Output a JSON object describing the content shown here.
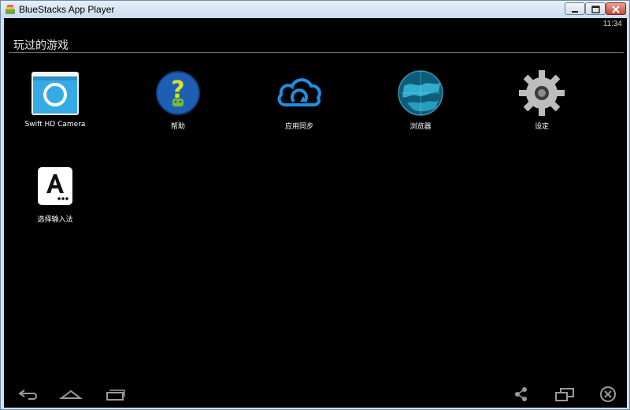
{
  "window": {
    "title": "BlueStacks App Player",
    "controls": {
      "minimize": "minimize-icon",
      "maximize": "maximize-icon",
      "close": "close-icon"
    }
  },
  "status_bar": {
    "time": "11:34"
  },
  "section": {
    "title": "玩过的游戏"
  },
  "apps": [
    {
      "label": "Swift HD Camera",
      "icon": "camera-icon"
    },
    {
      "label": "帮助",
      "icon": "help-icon"
    },
    {
      "label": "应用同步",
      "icon": "cloud-sync-icon"
    },
    {
      "label": "浏览器",
      "icon": "globe-icon"
    },
    {
      "label": "设定",
      "icon": "gear-icon"
    },
    {
      "label": "选择输入法",
      "icon": "input-method-icon"
    }
  ],
  "nav_bar": {
    "left": [
      "back-icon",
      "home-icon",
      "recent-apps-icon"
    ],
    "right": [
      "share-icon",
      "multi-window-icon",
      "close-icon"
    ]
  },
  "colors": {
    "screen_bg": "#000000",
    "camera_blue": "#35aae5",
    "help_blue": "#1f5fb3",
    "help_yellow": "#d9e12a",
    "cloud_blue": "#1f8fe0",
    "gear_gray": "#bdbdbd"
  }
}
